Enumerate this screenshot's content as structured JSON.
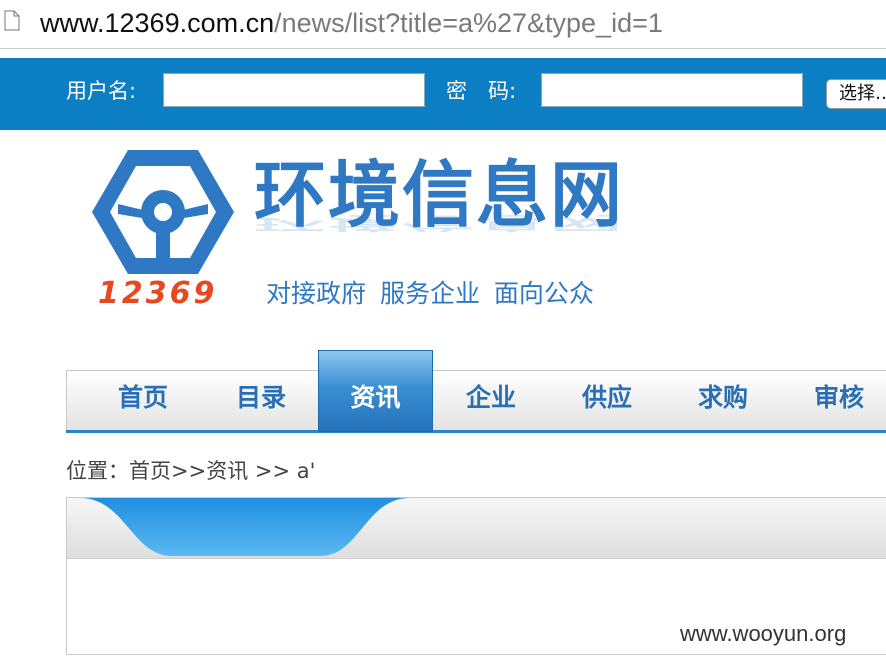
{
  "browser": {
    "url_host": "www.12369.com.cn",
    "url_path": "/news/list?title=a%27&type_id=1"
  },
  "login": {
    "username_label": "用户名:",
    "username_value": "",
    "password_label": "密　码:",
    "password_value": "",
    "choose_button": "选择…"
  },
  "logo": {
    "title": "环境信息网",
    "number": "12369",
    "slogan": "对接政府 服务企业 面向公众"
  },
  "nav": {
    "items": [
      "首页",
      "目录",
      "资讯",
      "企业",
      "供应",
      "求购",
      "审核"
    ],
    "active_index": 2
  },
  "breadcrumb": "位置：首页>>资讯 >> a'",
  "watermark": "www.wooyun.org",
  "colors": {
    "topbar": "#0b7ec4",
    "nav_text": "#2a6fb3",
    "logo_blue": "#2f78c4",
    "logo_red": "#e8481f"
  }
}
